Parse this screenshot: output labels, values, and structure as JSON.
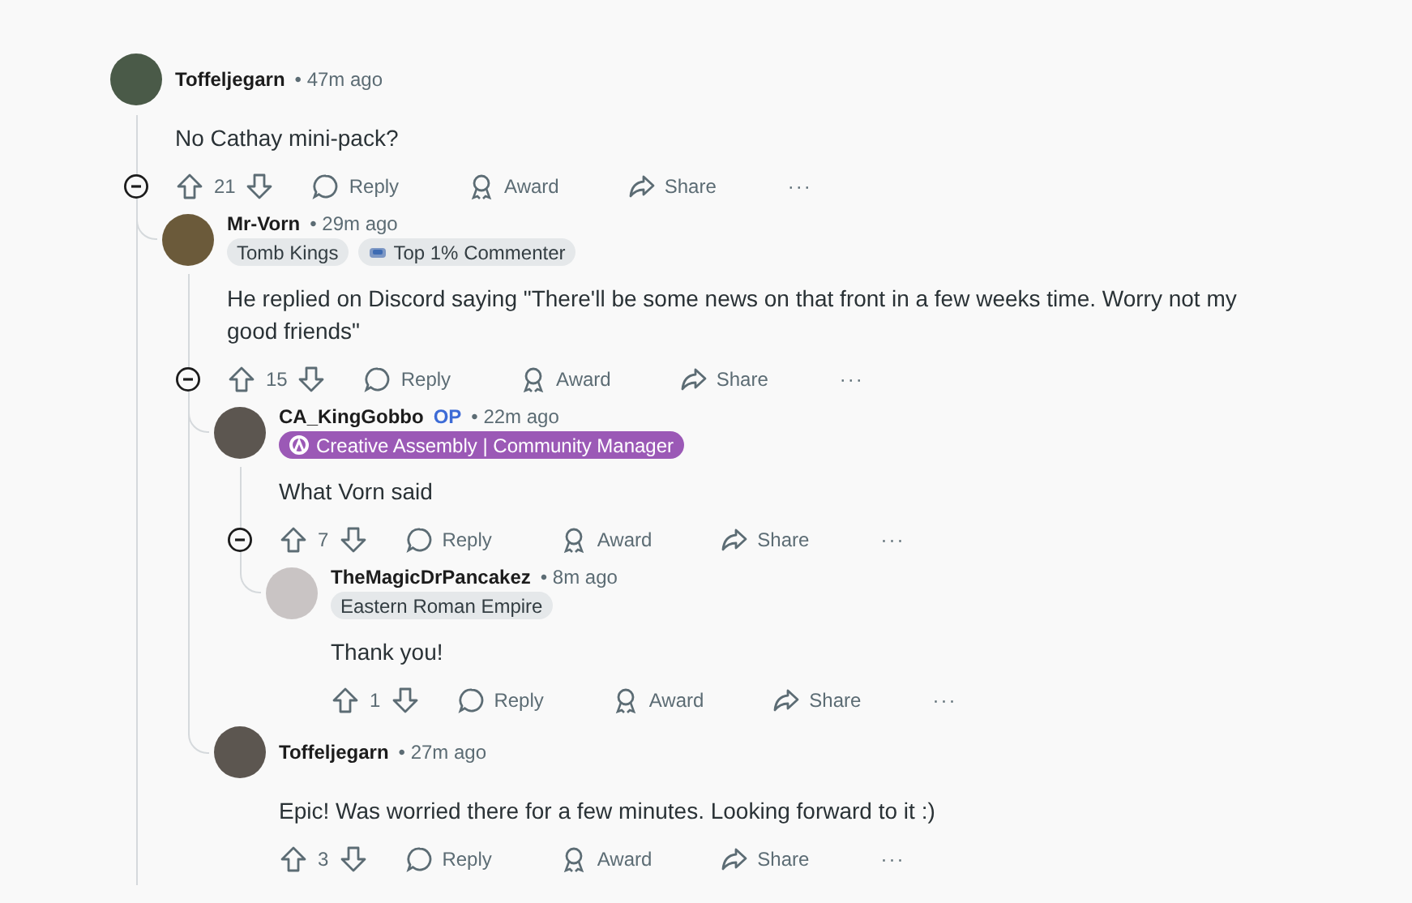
{
  "comments": [
    {
      "author": "Toffeljegarn",
      "time": "• 47m ago",
      "text": "No Cathay mini-pack?",
      "score": "21",
      "expanded": true,
      "actions": [
        "Reply",
        "Award",
        "Share"
      ],
      "more": "···",
      "children": [
        {
          "author": "Mr-Vorn",
          "time": "• 29m ago",
          "flairs": [
            {
              "kind": "user",
              "text": "Tomb Kings"
            },
            {
              "kind": "achievement",
              "text": "Top 1% Commenter"
            }
          ],
          "text": "He replied on Discord saying \"There'll be some news on that front in a few weeks time. Worry not my good friends\"",
          "score": "15",
          "expanded": true,
          "actions": [
            "Reply",
            "Award",
            "Share"
          ],
          "more": "···",
          "children": [
            {
              "author": "CA_KingGobbo",
              "op": "OP",
              "time": "• 22m ago",
              "flairs": [
                {
                  "kind": "official",
                  "text": "Creative Assembly | Community Manager"
                }
              ],
              "text": "What Vorn said",
              "score": "7",
              "expanded": true,
              "actions": [
                "Reply",
                "Award",
                "Share"
              ],
              "more": "···",
              "children": [
                {
                  "author": "TheMagicDrPancakez",
                  "time": "• 8m ago",
                  "flairs": [
                    {
                      "kind": "user",
                      "text": "Eastern Roman Empire"
                    }
                  ],
                  "text": "Thank you!",
                  "score": "1",
                  "actions": [
                    "Reply",
                    "Award",
                    "Share"
                  ],
                  "more": "···"
                }
              ]
            },
            {
              "author": "Toffeljegarn",
              "time": "• 27m ago",
              "text": "Epic! Was worried there for a few minutes. Looking forward to it :)",
              "score": "3",
              "actions": [
                "Reply",
                "Award",
                "Share"
              ],
              "more": "···"
            }
          ]
        }
      ]
    }
  ]
}
